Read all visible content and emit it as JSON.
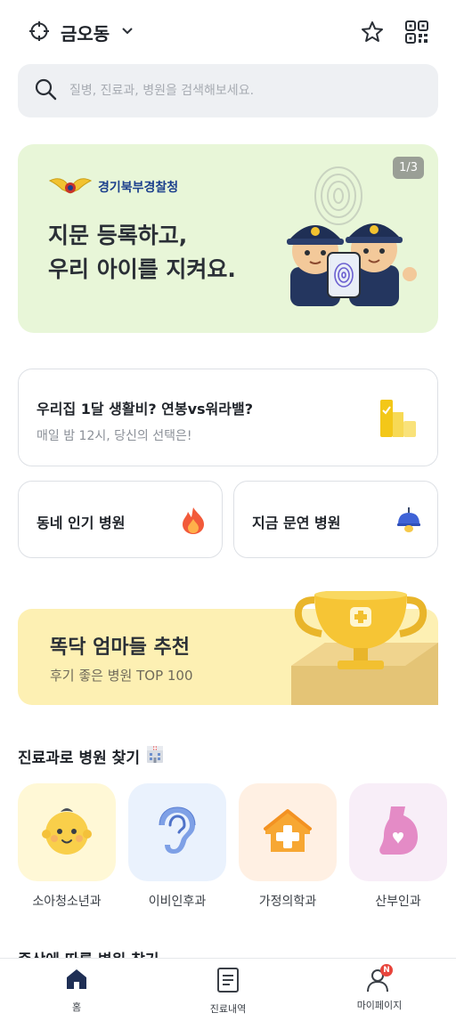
{
  "header": {
    "location": "금오동",
    "icons": [
      "crosshair-icon",
      "chevron-down-icon",
      "star-icon",
      "qr-code-icon"
    ]
  },
  "search": {
    "placeholder": "질병, 진료과, 병원을 검색해보세요."
  },
  "banner": {
    "org_name": "경기북부경찰청",
    "headline_line1": "지문 등록하고,",
    "headline_line2": "우리 아이를 지켜요.",
    "pager": "1/3",
    "bg_color": "#e8f6d8"
  },
  "cards": {
    "wide": {
      "title": "우리집 1달 생활비? 연봉vs워라밸?",
      "subtitle": "매일 밤 12시, 당신의 선택은!",
      "icon": "bar-chart-icon"
    },
    "popular": {
      "title": "동네 인기 병원",
      "icon": "fire-icon"
    },
    "open_now": {
      "title": "지금 문연 병원",
      "icon": "lamp-icon"
    }
  },
  "promo": {
    "title": "똑닥 엄마들 추천",
    "subtitle": "후기 좋은 병원 TOP 100",
    "bg_color": "#fdf0b3"
  },
  "departments": {
    "title": "진료과로 병원 찾기",
    "items": [
      {
        "label": "소아청소년과",
        "icon": "baby-face-icon",
        "bg": "#fff8d6"
      },
      {
        "label": "이비인후과",
        "icon": "ear-icon",
        "bg": "#eaf2fd"
      },
      {
        "label": "가정의학과",
        "icon": "house-cross-icon",
        "bg": "#fff0e3"
      },
      {
        "label": "산부인과",
        "icon": "pregnant-icon",
        "bg": "#f8eef8"
      }
    ]
  },
  "symptoms": {
    "title": "증상에 따른 병원 찾기"
  },
  "tabbar": {
    "items": [
      {
        "label": "홈",
        "icon": "home-icon"
      },
      {
        "label": "진료내역",
        "icon": "document-icon"
      },
      {
        "label": "마이페이지",
        "icon": "profile-icon"
      }
    ],
    "badge": "N"
  }
}
